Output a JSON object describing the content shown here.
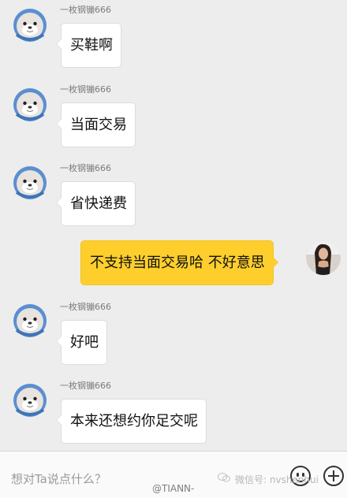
{
  "messages": [
    {
      "type": "received",
      "sender": "一枚钢镚666",
      "text": "买鞋啊"
    },
    {
      "type": "received",
      "sender": "一枚钢镚666",
      "text": "当面交易"
    },
    {
      "type": "received",
      "sender": "一枚钢镚666",
      "text": "省快递费"
    },
    {
      "type": "sent",
      "text": "不支持当面交易哈 不好意思"
    },
    {
      "type": "received",
      "sender": "一枚钢镚666",
      "text": "好吧"
    },
    {
      "type": "received",
      "sender": "一枚钢镚666",
      "text": "本来还想约你足交呢"
    }
  ],
  "input": {
    "placeholder": "想对Ta说点什么？",
    "emoji_icon": "emoji-icon",
    "plus_icon": "plus-icon"
  },
  "watermarks": {
    "wechat": "微信号: nvshenhui",
    "handle": "@TIANN-"
  },
  "colors": {
    "sent_bubble": "#fecf2c",
    "received_bubble": "#ffffff",
    "background": "#ededed"
  }
}
